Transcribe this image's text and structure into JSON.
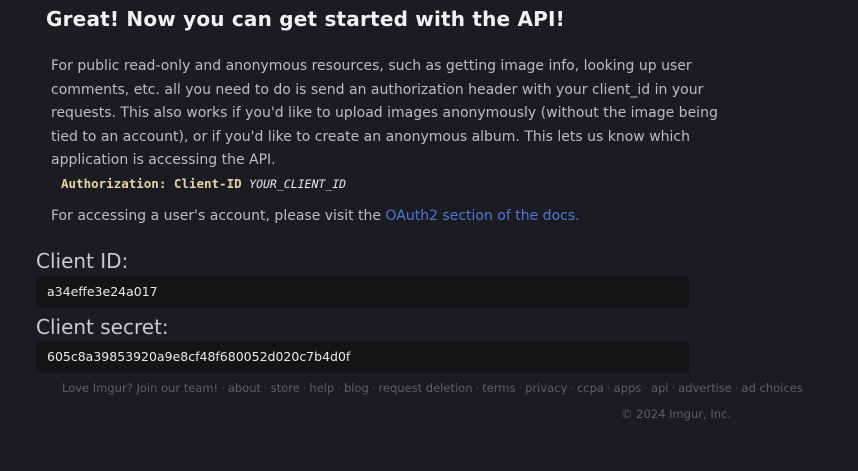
{
  "heading": "Great! Now you can get started with the API!",
  "intro_paragraph": "For public read-only and anonymous resources, such as getting image info, looking up user comments, etc. all you need to do is send an authorization header with your client_id in your requests. This also works if you'd like to upload images anonymously (without the image being tied to an account), or if you'd like to create an anonymous album. This lets us know which application is accessing the API.",
  "auth_header": {
    "prefix": "Authorization: Client-ID ",
    "placeholder": "YOUR_CLIENT_ID"
  },
  "oauth": {
    "text": "For accessing a user's account, please visit the ",
    "link_text": "OAuth2 section of the docs."
  },
  "client_id": {
    "label": "Client ID:",
    "value": "a34effe3e24a017"
  },
  "client_secret": {
    "label": "Client secret:",
    "value": "605c8a39853920a9e8cf48f680052d020c7b4d0f"
  },
  "footer": {
    "links": [
      "Love Imgur? Join our team!",
      "about",
      "store",
      "help",
      "blog",
      "request deletion",
      "terms",
      "privacy",
      "ccpa",
      "apps",
      "api",
      "advertise",
      "ad choices"
    ],
    "separator": "·",
    "copyright": "© 2024 Imgur, Inc."
  }
}
